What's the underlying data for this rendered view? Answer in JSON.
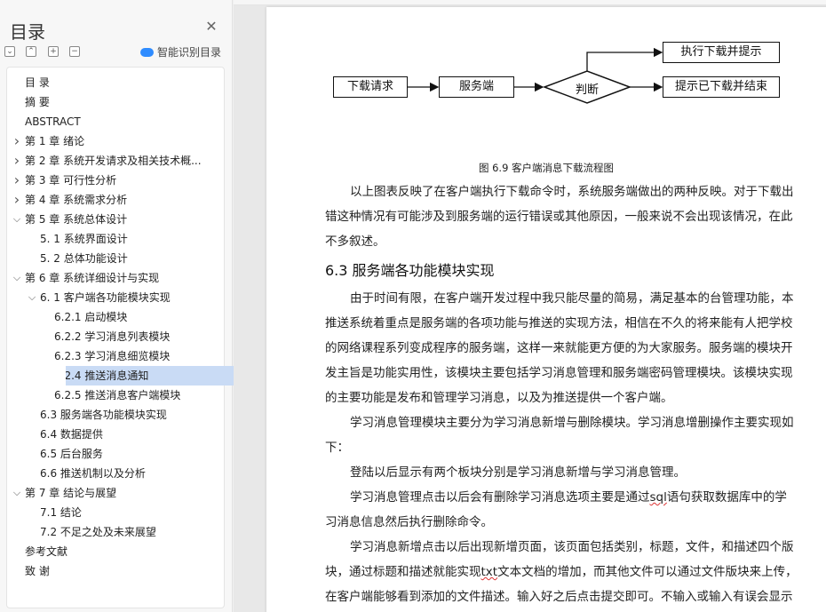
{
  "sidebar": {
    "title": "目录",
    "close_icon": "close-icon",
    "tools": [
      "collapse-all-icon",
      "expand-level-icon",
      "add-icon",
      "remove-icon"
    ],
    "ai_toc_label": "智能识别目录",
    "items": [
      {
        "label": "目  录",
        "level": 0,
        "arrow": ""
      },
      {
        "label": "摘  要",
        "level": 0,
        "arrow": ""
      },
      {
        "label": "ABSTRACT",
        "level": 0,
        "arrow": ""
      },
      {
        "label": "第 1 章  绪论",
        "level": 0,
        "arrow": "right"
      },
      {
        "label": "第 2 章  系统开发请求及相关技术概...",
        "level": 0,
        "arrow": "right"
      },
      {
        "label": "第 3 章  可行性分析",
        "level": 0,
        "arrow": "right"
      },
      {
        "label": "第 4 章  系统需求分析",
        "level": 0,
        "arrow": "right"
      },
      {
        "label": "第 5 章  系统总体设计",
        "level": 0,
        "arrow": "down"
      },
      {
        "label": "5. 1  系统界面设计",
        "level": 1,
        "arrow": ""
      },
      {
        "label": "5. 2  总体功能设计",
        "level": 1,
        "arrow": ""
      },
      {
        "label": "第 6 章  系统详细设计与实现",
        "level": 0,
        "arrow": "down"
      },
      {
        "label": "6. 1  客户端各功能模块实现",
        "level": 1,
        "arrow": "down"
      },
      {
        "label": "6.2.1  启动模块",
        "level": 2,
        "arrow": ""
      },
      {
        "label": "6.2.2  学习消息列表模块",
        "level": 2,
        "arrow": ""
      },
      {
        "label": "6.2.3  学习消息细览模块",
        "level": 2,
        "arrow": ""
      },
      {
        "label": "6.2.4  推送消息通知",
        "level": 2,
        "arrow": "",
        "selected": true
      },
      {
        "label": "6.2.5  推送消息客户端模块",
        "level": 2,
        "arrow": ""
      },
      {
        "label": "6.3  服务端各功能模块实现",
        "level": 1,
        "arrow": ""
      },
      {
        "label": "6.4  数据提供",
        "level": 1,
        "arrow": ""
      },
      {
        "label": "6.5  后台服务",
        "level": 1,
        "arrow": ""
      },
      {
        "label": "6.6  推送机制以及分析",
        "level": 1,
        "arrow": ""
      },
      {
        "label": "第 7 章  结论与展望",
        "level": 0,
        "arrow": "down"
      },
      {
        "label": "7.1  结论",
        "level": 1,
        "arrow": ""
      },
      {
        "label": "7.2  不足之处及未来展望",
        "level": 1,
        "arrow": ""
      },
      {
        "label": "参考文献",
        "level": 0,
        "arrow": ""
      },
      {
        "label": "致  谢",
        "level": 0,
        "arrow": ""
      }
    ]
  },
  "flowchart": {
    "download_request": "下载请求",
    "server": "服务端",
    "decision": "判断",
    "execute_download": "执行下载并提示",
    "already_downloaded": "提示已下载并结束"
  },
  "figure_caption": "图 6.9  客户端消息下载流程图",
  "para1": [
    "以上图表反映了在客户端执行下载命令时，系统服务端做出的两种反映。对于下载出",
    "错这种情况有可能涉及到服务端的运行错误或其他原因，一般来说不会出现该情况，在此",
    "不多叙述。"
  ],
  "section_heading": "6.3  服务端各功能模块实现",
  "para2": [
    "由于时间有限，在客户端开发过程中我只能尽量的简易，满足基本的台管理功能，本",
    "推送系统着重点是服务端的各项功能与推送的实现方法，相信在不久的将来能有人把学校",
    "的网络课程系列变成程序的服务端，这样一来就能更方便的为大家服务。服务端的模块开",
    "发主旨是功能实用性，该模块主要包括学习消息管理和服务端密码管理模块。该模块实现",
    "的主要功能是发布和管理学习消息，以及为推送提供一个客户端。"
  ],
  "para3": [
    "学习消息管理模块主要分为学习消息新增与删除模块。学习消息增删操作主要实现如",
    "下："
  ],
  "para4": "登陆以后显示有两个板块分别是学习消息新增与学习消息管理。",
  "para5": {
    "line1_a": "学习消息管理点击以后会有删除学习消息选项主要是通过",
    "line1_sql": "sql",
    "line1_b": "语句获取数据库中的学",
    "line2": "习消息信息然后执行删除命令。"
  },
  "para6": {
    "line1": "学习消息新增点击以后出现新增页面，该页面包括类别，标题，文件，和描述四个版",
    "line2_a": "块，通过标题和描述就能实现",
    "line2_txt": "txt",
    "line2_b": "文本文档的增加，而其他文件可以通过文件版块来上传，",
    "line3": "在客户端能够看到添加的文件描述。输入好之后点击提交即可。不输入或输入有误会显示"
  }
}
